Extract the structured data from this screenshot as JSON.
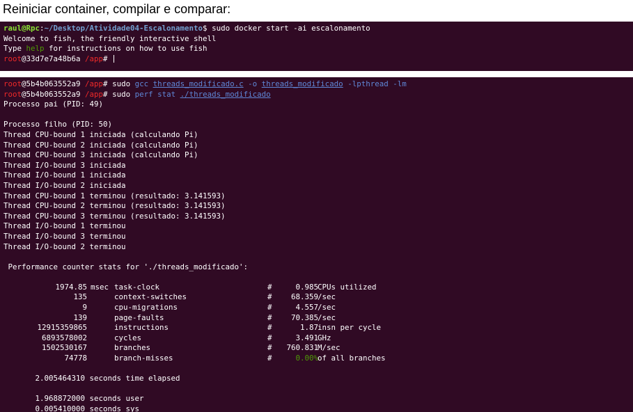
{
  "heading": "Reiniciar container, compilar e comparar:",
  "terminal1": {
    "host_prompt": {
      "user": "raul@Rpc",
      "path": "~/Desktop/Atividade04-Escalonamento",
      "sep": ":",
      "symbol": "$",
      "command": " sudo docker start -ai escalonamento"
    },
    "welcome": "Welcome to fish, the friendly interactive shell",
    "type_prefix": "Type ",
    "type_help": "help",
    "type_suffix": " for instructions on how to use fish",
    "fish_prompt": {
      "user": "root",
      "host": "@33d7e7a48b6a",
      "dir": " /app",
      "symbol": "# "
    }
  },
  "terminal2": {
    "prompt1": {
      "user": "root",
      "host": "@5b4b063552a9",
      "dir": " /app",
      "symbol": "# ",
      "sudo": "sudo ",
      "cmd": "gcc",
      "file1": "threads_modificado.c",
      "opt_o": "-o",
      "file2": "threads_modificado",
      "libs": "-lpthread -lm"
    },
    "prompt2": {
      "user": "root",
      "host": "@5b4b063552a9",
      "dir": " /app",
      "symbol": "# ",
      "sudo": "sudo ",
      "cmd": "perf stat",
      "file": "./threads_modificado"
    },
    "output_lines": [
      "Processo pai (PID: 49)",
      "",
      "Processo filho (PID: 50)",
      "Thread CPU-bound 1 iniciada (calculando Pi)",
      "Thread CPU-bound 2 iniciada (calculando Pi)",
      "Thread CPU-bound 3 iniciada (calculando Pi)",
      "Thread I/O-bound 3 iniciada",
      "Thread I/O-bound 1 iniciada",
      "Thread I/O-bound 2 iniciada",
      "Thread CPU-bound 1 terminou (resultado: 3.141593)",
      "Thread CPU-bound 2 terminou (resultado: 3.141593)",
      "Thread CPU-bound 3 terminou (resultado: 3.141593)",
      "Thread I/O-bound 1 terminou",
      "Thread I/O-bound 3 terminou",
      "Thread I/O-bound 2 terminou",
      "",
      " Performance counter stats for './threads_modificado':",
      ""
    ],
    "stats": [
      {
        "value": "1974.85",
        "unit": "msec",
        "name": "task-clock",
        "hash": "#",
        "ratio": "0.985",
        "desc": "CPUs utilized"
      },
      {
        "value": "135",
        "unit": "",
        "name": "context-switches",
        "hash": "#",
        "ratio": "68.359",
        "desc": "/sec"
      },
      {
        "value": "9",
        "unit": "",
        "name": "cpu-migrations",
        "hash": "#",
        "ratio": "4.557",
        "desc": "/sec"
      },
      {
        "value": "139",
        "unit": "",
        "name": "page-faults",
        "hash": "#",
        "ratio": "70.385",
        "desc": "/sec"
      },
      {
        "value": "12915359865",
        "unit": "",
        "name": "instructions",
        "hash": "#",
        "ratio": "1.87",
        "desc": "insn per cycle"
      },
      {
        "value": "6893578002",
        "unit": "",
        "name": "cycles",
        "hash": "#",
        "ratio": "3.491",
        "desc": "GHz"
      },
      {
        "value": "1502530167",
        "unit": "",
        "name": "branches",
        "hash": "#",
        "ratio": "760.831",
        "desc": "M/sec"
      },
      {
        "value": "74778",
        "unit": "",
        "name": "branch-misses",
        "hash": "#",
        "ratio": "0.00%",
        "desc": "of all branches"
      }
    ],
    "elapsed": "       2.005464310 seconds time elapsed",
    "user_time": "       1.968872000 seconds user",
    "sys_time": "       0.005410000 seconds sys"
  }
}
